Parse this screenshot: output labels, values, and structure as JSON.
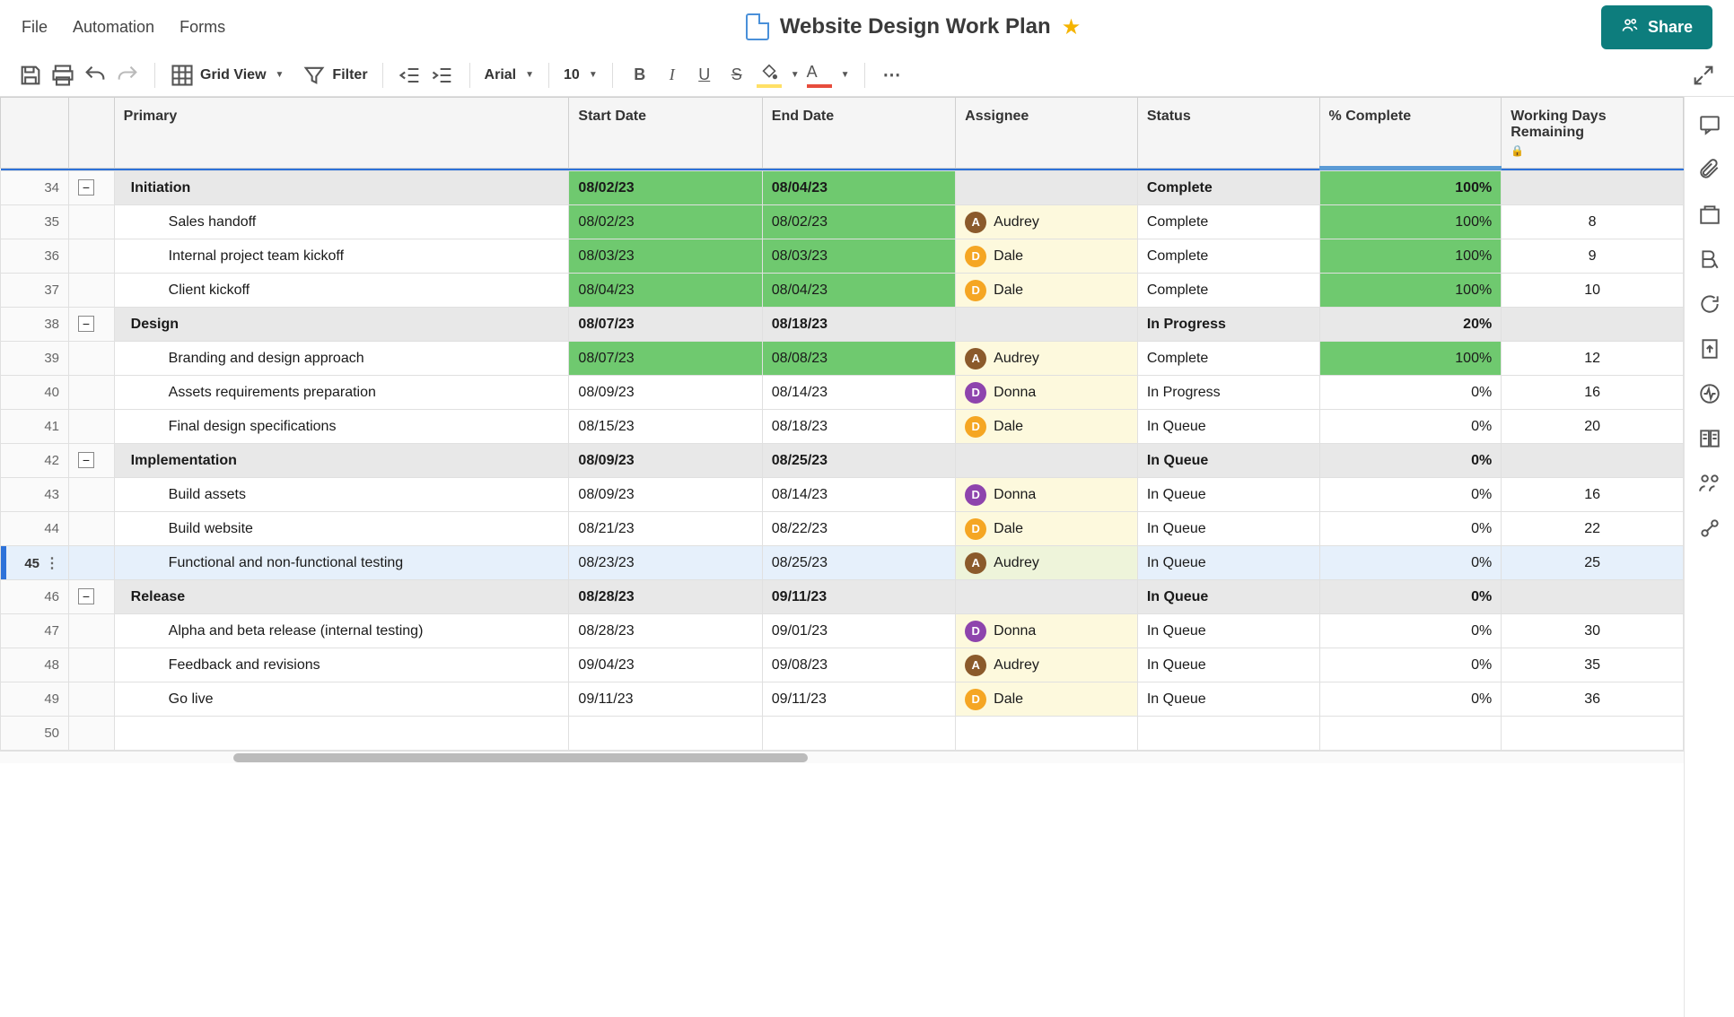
{
  "menu": {
    "file": "File",
    "automation": "Automation",
    "forms": "Forms"
  },
  "title": "Website Design Work Plan",
  "share": "Share",
  "toolbar": {
    "view": "Grid View",
    "filter": "Filter",
    "font": "Arial",
    "size": "10"
  },
  "columns": {
    "primary": "Primary",
    "start": "Start Date",
    "end": "End Date",
    "assignee": "Assignee",
    "status": "Status",
    "pct": "% Complete",
    "days": "Working Days Remaining"
  },
  "assignees": {
    "audrey": {
      "initial": "A",
      "name": "Audrey",
      "cls": "av-audrey"
    },
    "dale": {
      "initial": "D",
      "name": "Dale",
      "cls": "av-dale"
    },
    "donna": {
      "initial": "D",
      "name": "Donna",
      "cls": "av-donna"
    }
  },
  "rows": [
    {
      "num": 34,
      "type": "phase",
      "name": "Initiation",
      "start": "08/02/23",
      "end": "08/04/23",
      "status": "Complete",
      "pct": "100%",
      "startGreen": true,
      "endGreen": true,
      "pctGreen": true
    },
    {
      "num": 35,
      "type": "task",
      "name": "Sales handoff",
      "start": "08/02/23",
      "end": "08/02/23",
      "assignee": "audrey",
      "status": "Complete",
      "pct": "100%",
      "days": "8",
      "startGreen": true,
      "endGreen": true,
      "pctGreen": true
    },
    {
      "num": 36,
      "type": "task",
      "name": "Internal project team kickoff",
      "start": "08/03/23",
      "end": "08/03/23",
      "assignee": "dale",
      "status": "Complete",
      "pct": "100%",
      "days": "9",
      "startGreen": true,
      "endGreen": true,
      "pctGreen": true
    },
    {
      "num": 37,
      "type": "task",
      "name": "Client kickoff",
      "start": "08/04/23",
      "end": "08/04/23",
      "assignee": "dale",
      "status": "Complete",
      "pct": "100%",
      "days": "10",
      "startGreen": true,
      "endGreen": true,
      "pctGreen": true
    },
    {
      "num": 38,
      "type": "phase",
      "name": "Design",
      "start": "08/07/23",
      "end": "08/18/23",
      "status": "In Progress",
      "pct": "20%"
    },
    {
      "num": 39,
      "type": "task",
      "name": "Branding and design approach",
      "start": "08/07/23",
      "end": "08/08/23",
      "assignee": "audrey",
      "status": "Complete",
      "pct": "100%",
      "days": "12",
      "startGreen": true,
      "endGreen": true,
      "pctGreen": true
    },
    {
      "num": 40,
      "type": "task",
      "name": "Assets requirements preparation",
      "start": "08/09/23",
      "end": "08/14/23",
      "assignee": "donna",
      "status": "In Progress",
      "pct": "0%",
      "days": "16"
    },
    {
      "num": 41,
      "type": "task",
      "name": "Final design specifications",
      "start": "08/15/23",
      "end": "08/18/23",
      "assignee": "dale",
      "status": "In Queue",
      "pct": "0%",
      "days": "20"
    },
    {
      "num": 42,
      "type": "phase",
      "name": "Implementation",
      "start": "08/09/23",
      "end": "08/25/23",
      "status": "In Queue",
      "pct": "0%"
    },
    {
      "num": 43,
      "type": "task",
      "name": "Build assets",
      "start": "08/09/23",
      "end": "08/14/23",
      "assignee": "donna",
      "status": "In Queue",
      "pct": "0%",
      "days": "16"
    },
    {
      "num": 44,
      "type": "task",
      "name": "Build website",
      "start": "08/21/23",
      "end": "08/22/23",
      "assignee": "dale",
      "status": "In Queue",
      "pct": "0%",
      "days": "22"
    },
    {
      "num": 45,
      "type": "task",
      "selected": true,
      "name": "Functional and non-functional testing",
      "start": "08/23/23",
      "end": "08/25/23",
      "assignee": "audrey",
      "status": "In Queue",
      "pct": "0%",
      "days": "25"
    },
    {
      "num": 46,
      "type": "phase",
      "name": "Release",
      "start": "08/28/23",
      "end": "09/11/23",
      "status": "In Queue",
      "pct": "0%"
    },
    {
      "num": 47,
      "type": "task",
      "name": "Alpha and beta release (internal testing)",
      "start": "08/28/23",
      "end": "09/01/23",
      "assignee": "donna",
      "status": "In Queue",
      "pct": "0%",
      "days": "30"
    },
    {
      "num": 48,
      "type": "task",
      "name": "Feedback and revisions",
      "start": "09/04/23",
      "end": "09/08/23",
      "assignee": "audrey",
      "status": "In Queue",
      "pct": "0%",
      "days": "35"
    },
    {
      "num": 49,
      "type": "task",
      "name": "Go live",
      "start": "09/11/23",
      "end": "09/11/23",
      "assignee": "dale",
      "status": "In Queue",
      "pct": "0%",
      "days": "36"
    },
    {
      "num": 50,
      "type": "empty"
    }
  ]
}
